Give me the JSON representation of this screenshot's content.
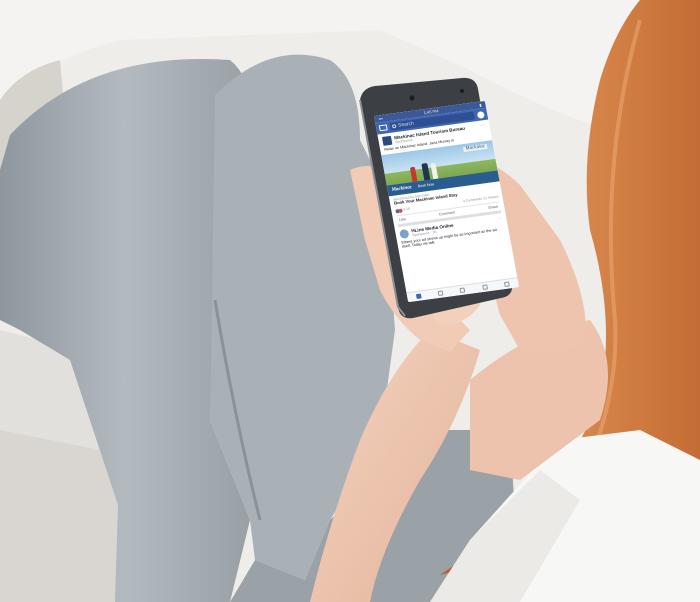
{
  "screen": {
    "status_time": "1:45 PM",
    "search_placeholder": "Search",
    "post1": {
      "page_name": "Mackinac Island Tourism Bureau",
      "sponsored": "Sponsored",
      "text": "Relax on Mackinac Island. Jana Murray is",
      "image_logo": "Mackinac",
      "banner_brand": "Mackinac",
      "banner_text": "Book Now",
      "link_domain": "MACKINACISLAND.ORG",
      "link_title": "Book Your Mackinac Island Stay",
      "reactions": "3.1K",
      "comments": "4 Comments",
      "shares": "12 Shares",
      "like": "Like",
      "comment": "Comment",
      "share": "Share"
    },
    "post2": {
      "name": "HLine Media Online",
      "meta": "Sponsored · 3h",
      "text": "Where your ad shows up might be as important as the ad itself. Today we talk"
    }
  },
  "colors": {
    "fb_blue": "#4267b2",
    "wall": "#ecebe8",
    "leggings": "#a8b0b6",
    "hair": "#c9733e",
    "shirt": "#f7f7f5",
    "skin": "#efc8b3"
  }
}
